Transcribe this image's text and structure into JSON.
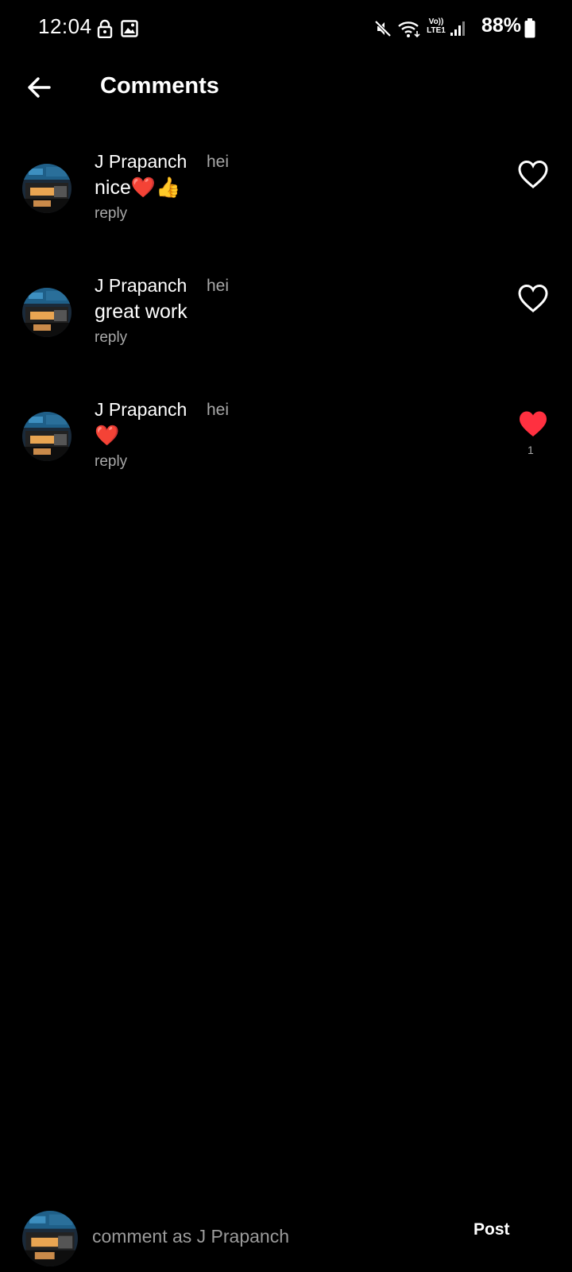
{
  "status_bar": {
    "time": "12:04",
    "network_label": "Vo)) LTE1",
    "battery": "88%"
  },
  "header": {
    "title": "Comments",
    "back_icon": "arrow-left-icon"
  },
  "comments": [
    {
      "author": "J Prapanch",
      "time": "hei",
      "text": "nice❤️👍",
      "reply_label": "reply",
      "liked": false,
      "like_count": ""
    },
    {
      "author": "J Prapanch",
      "time": "hei",
      "text": "great work",
      "reply_label": "reply",
      "liked": false,
      "like_count": ""
    },
    {
      "author": "J Prapanch",
      "time": "hei",
      "text": "❤️",
      "reply_label": "reply",
      "liked": true,
      "like_count": "1"
    }
  ],
  "composer": {
    "placeholder": "comment as J Prapanch",
    "value": "",
    "post_label": "Post"
  },
  "colors": {
    "background": "#000000",
    "text": "#ffffff",
    "muted": "#a8a8a8",
    "like_active": "#ff3040"
  }
}
